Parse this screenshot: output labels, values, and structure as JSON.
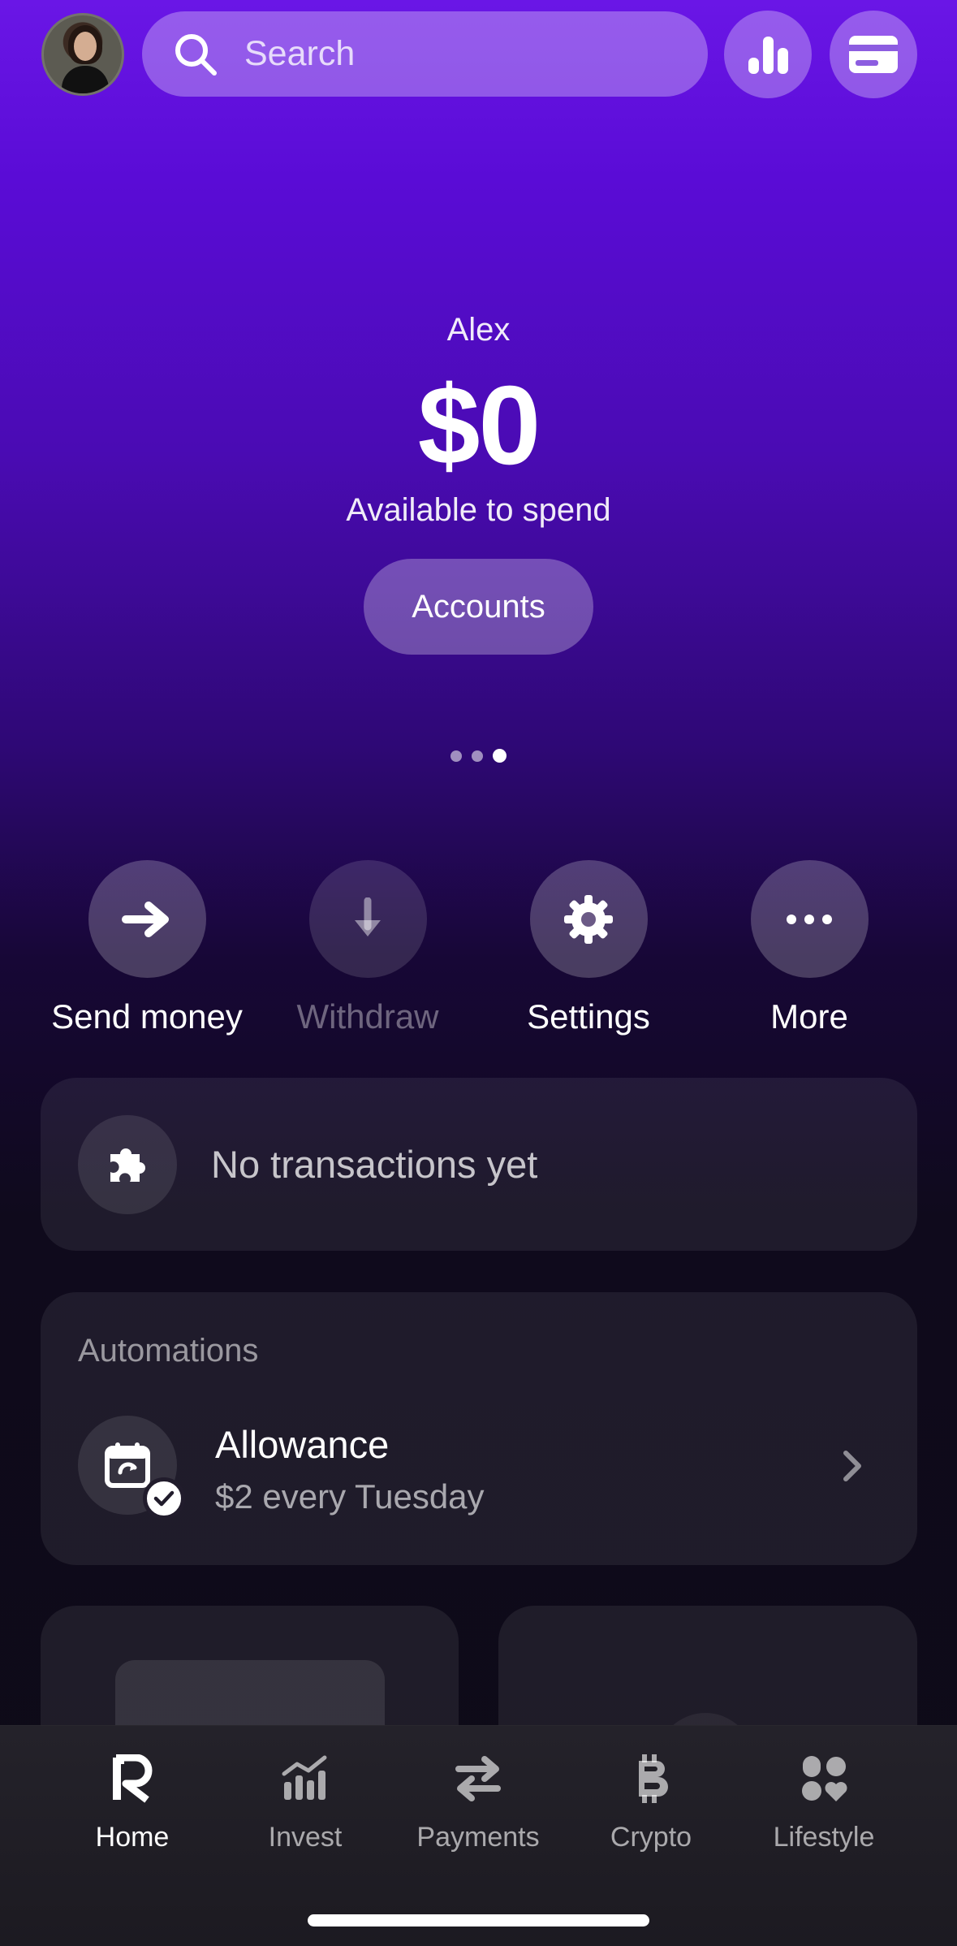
{
  "header": {
    "search_placeholder": "Search",
    "avatar_icon": "avatar",
    "stats_icon": "bar-chart-icon",
    "card_icon": "card-icon"
  },
  "balance": {
    "owner": "Alex",
    "amount": "$0",
    "caption": "Available to spend",
    "accounts_label": "Accounts",
    "carousel_pages": 3,
    "carousel_active": 3
  },
  "actions": [
    {
      "label": "Send money",
      "icon": "arrow-right-icon",
      "enabled": true
    },
    {
      "label": "Withdraw",
      "icon": "arrow-down-icon",
      "enabled": false
    },
    {
      "label": "Settings",
      "icon": "gear-icon",
      "enabled": true
    },
    {
      "label": "More",
      "icon": "ellipsis-icon",
      "enabled": true
    }
  ],
  "transactions": {
    "empty_text": "No transactions yet",
    "icon": "puzzle-icon"
  },
  "automations": {
    "title": "Automations",
    "item": {
      "name": "Allowance",
      "schedule": "$2 every Tuesday",
      "icon": "calendar-repeat-icon",
      "badge_icon": "check-icon"
    }
  },
  "nav": [
    {
      "label": "Home",
      "icon": "home-logo-icon",
      "active": true
    },
    {
      "label": "Invest",
      "icon": "invest-chart-icon",
      "active": false
    },
    {
      "label": "Payments",
      "icon": "transfer-arrows-icon",
      "active": false
    },
    {
      "label": "Crypto",
      "icon": "bitcoin-icon",
      "active": false
    },
    {
      "label": "Lifestyle",
      "icon": "lifestyle-icon",
      "active": false
    }
  ],
  "colors": {
    "gradient_top": "#6a16e6",
    "gradient_mid": "#2e0875",
    "background_bottom": "#0e0b17"
  }
}
